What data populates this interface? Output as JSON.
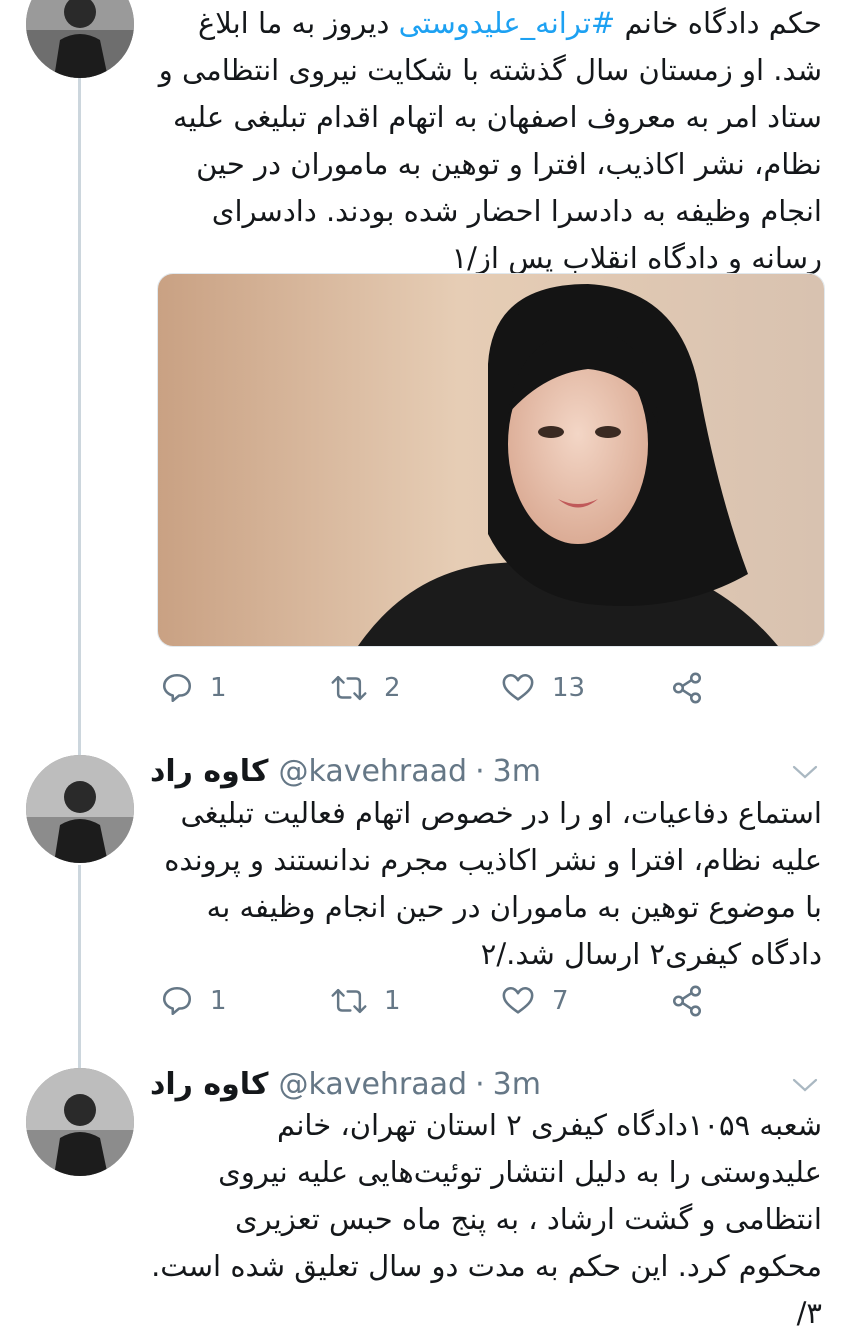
{
  "tweets": [
    {
      "id": "tweet-1",
      "text_before_hashtag": "حکم دادگاه خانم ",
      "hashtag": "#ترانه_علیدوستی",
      "text_after_hashtag": " دیروز به ما ابلاغ شد. او زمستان سال گذشته با شکایت نیروی انتظامی و ستاد امر به معروف اصفهان به اتهام اقدام تبلیغی علیه نظام، نشر اکاذیب، افترا و توهین به ماموران در حین انجام وظیفه به دادسرا احضار شده بودند. دادسرای رسانه و دادگاه انقلاب پس از/۱",
      "actions": {
        "replies": "1",
        "retweets": "2",
        "likes": "13"
      }
    },
    {
      "id": "tweet-2",
      "name": "کاوه راد",
      "handle": "@kavehraad",
      "time": "3m",
      "text": "استماع دفاعیات، او را در خصوص اتهام فعالیت تبلیغی علیه نظام، افترا و نشر اکاذیب مجرم ندانستند و پرونده با موضوع توهین به ماموران در حین انجام وظیفه به دادگاه کیفری۲ ارسال شد./۲",
      "actions": {
        "replies": "1",
        "retweets": "1",
        "likes": "7"
      }
    },
    {
      "id": "tweet-3",
      "name": "کاوه راد",
      "handle": "@kavehraad",
      "time": "3m",
      "text": "شعبه ۱۰۵۹دادگاه کیفری ۲ استان تهران، خانم علیدوستی را به دلیل انتشار توئیت‌هایی علیه نیروی انتظامی و گشت ارشاد ، به پنج ماه حبس تعزیری محکوم کرد. این حکم به مدت دو سال تعلیق شده است. ۳/"
    }
  ],
  "separator": "·",
  "colors": {
    "accent": "#1da1f2",
    "muted": "#657786",
    "line": "#ccd6dd"
  },
  "icons": [
    "reply-icon",
    "retweet-icon",
    "like-icon",
    "share-icon",
    "chevron-down-icon"
  ]
}
